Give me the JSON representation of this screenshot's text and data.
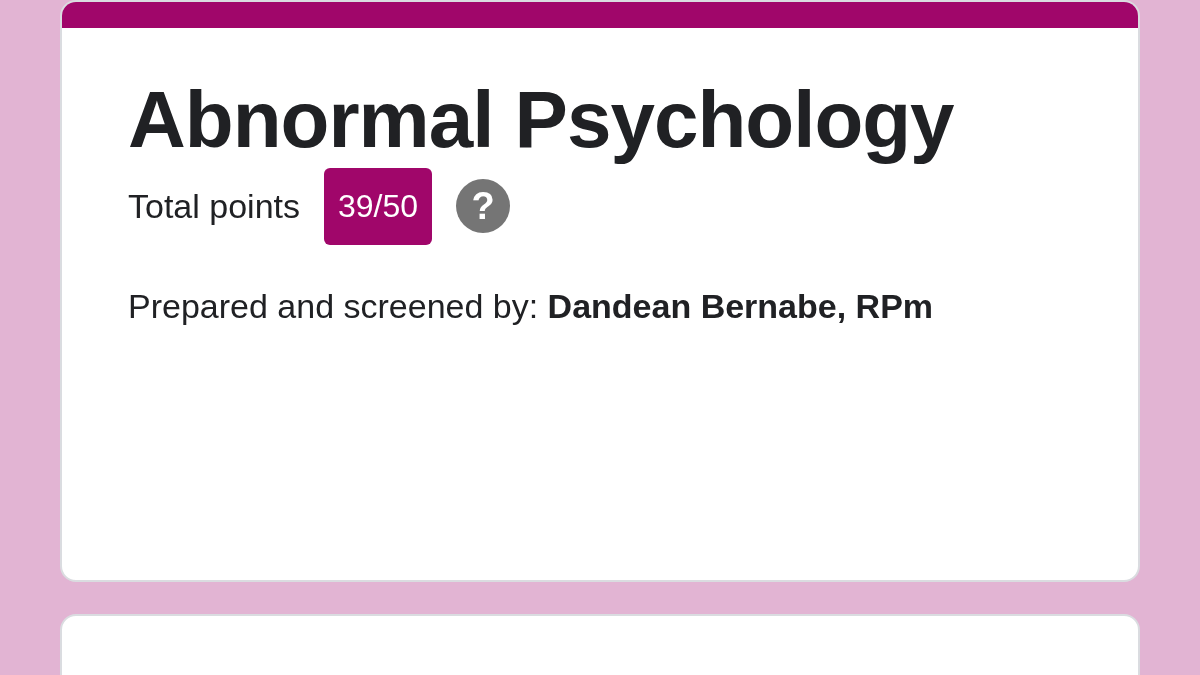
{
  "form": {
    "title": "Abnormal Psychology",
    "points_label": "Total points",
    "score": "39/50",
    "help": "?",
    "description": "Prepared and screened by: **Dandean Bernabe, RPm**"
  }
}
